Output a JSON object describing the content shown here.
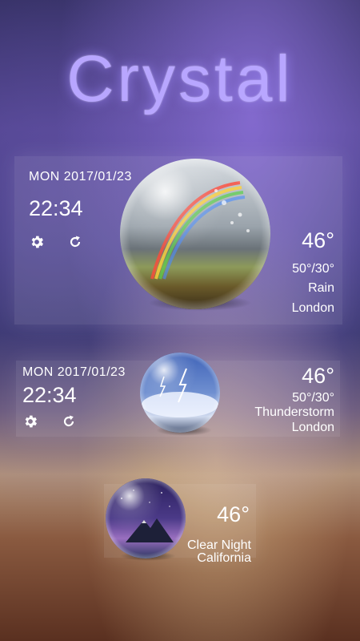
{
  "app": {
    "title": "Crystal"
  },
  "widget_large": {
    "date": "MON 2017/01/23",
    "time": "22:34",
    "temperature": "46°",
    "range": "50°/30°",
    "condition": "Rain",
    "city": "London",
    "settings_icon": "gear-icon",
    "refresh_icon": "refresh-icon"
  },
  "widget_medium": {
    "date": "MON 2017/01/23",
    "time": "22:34",
    "temperature": "46°",
    "range": "50°/30°",
    "condition": "Thunderstorm",
    "city": "London",
    "settings_icon": "gear-icon",
    "refresh_icon": "refresh-icon"
  },
  "widget_small": {
    "temperature": "46°",
    "condition": "Clear Night",
    "city": "California"
  },
  "colors": {
    "title": "#b8a6ff",
    "text": "#ffffff"
  }
}
